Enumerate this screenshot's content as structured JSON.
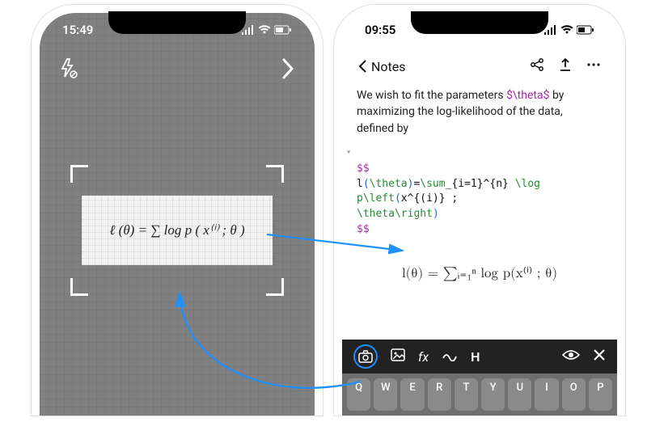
{
  "camera": {
    "status_time": "15:49",
    "handwritten": "ℓ (θ) = ∑ log p ( x⁽ⁱ⁾ ; θ )"
  },
  "editor": {
    "status_time": "09:55",
    "back_label": "Notes",
    "body_pre": "We wish to fit the parameters ",
    "body_tex": "$\\theta$",
    "body_post": " by maximizing the log-likelihood of the data, defined by",
    "code": {
      "dd_open": "$$",
      "line1_id": "l",
      "line1_br_open": "(",
      "line1_cmd1": "\\theta",
      "line1_br_close": ")",
      "line1_sym1": "=",
      "line1_cmd2": "\\sum",
      "line1_sub": "_{i=1}^{n}",
      "line1_cmd3": " \\log p",
      "line1_cmd4": "\\left",
      "line1_par": "(",
      "line1_arg": "x^{(i)}",
      "line1_sep": " ; ",
      "line2_cmd": "\\theta",
      "line2_cmd2": "\\right",
      "line2_par": ")",
      "dd_close": "$$"
    },
    "rendered_eq": "l(θ) = ∑ᵢ₌₁ⁿ log p(x⁽ⁱ⁾ ; θ)"
  },
  "keyboard": [
    "Q",
    "W",
    "E",
    "R",
    "T",
    "Y",
    "U",
    "I",
    "O",
    "P"
  ],
  "toolbar": {
    "fx": "fx",
    "h": "H"
  }
}
